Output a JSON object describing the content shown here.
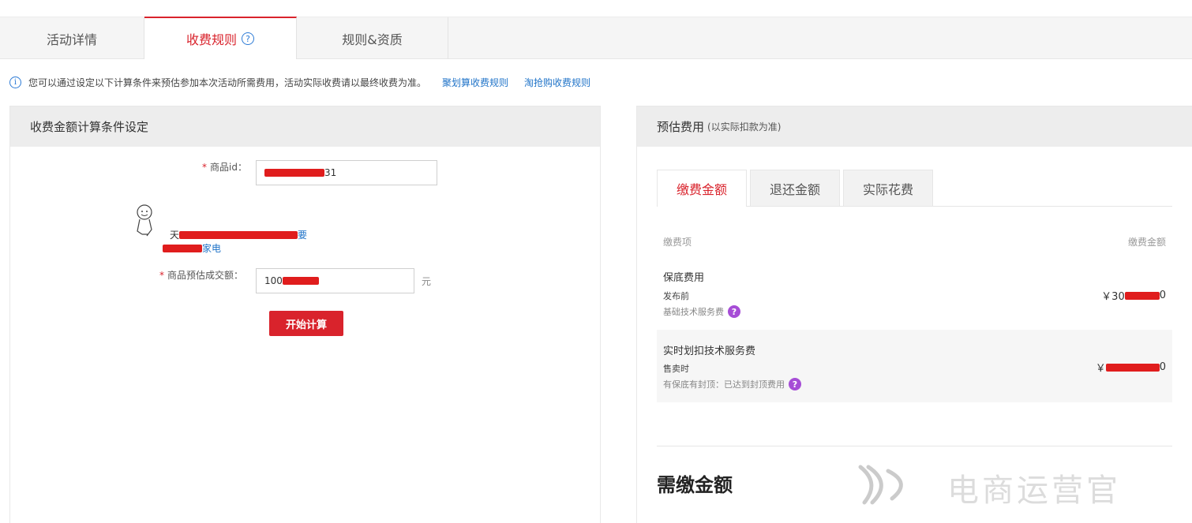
{
  "tabs": [
    {
      "label": "活动详情"
    },
    {
      "label": "收费规则",
      "help": "?"
    },
    {
      "label": "规则&资质"
    }
  ],
  "notice": {
    "text": "您可以通过设定以下计算条件来预估参加本次活动所需费用，活动实际收费请以最终收费为准。",
    "links": [
      "聚划算收费规则",
      "淘抢购收费规则"
    ]
  },
  "left_panel": {
    "title": "收费金额计算条件设定",
    "product_id_label": "商品id：",
    "product_id_value_tail": "31",
    "category_line1_tail": "要",
    "category_line2_tail": "家电",
    "deal_label": "商品预估成交额：",
    "deal_value_head": "100",
    "deal_unit": "元",
    "calc_button": "开始计算"
  },
  "right_panel": {
    "title": "预估费用",
    "title_note": "(以实际扣款为准)",
    "subtabs": [
      "缴费金额",
      "退还金额",
      "实际花费"
    ],
    "col_item": "缴费项",
    "col_amount": "缴费金额",
    "fees": [
      {
        "title": "保底费用",
        "timing": "发布前",
        "note": "基础技术服务费",
        "amount_head": "￥30",
        "amount_tail": "0"
      },
      {
        "title": "实时划扣技术服务费",
        "timing": "售卖时",
        "note": "有保底有封顶：已达到封顶费用",
        "amount_head": "￥",
        "amount_tail": "0"
      }
    ],
    "total_label": "需缴金额"
  },
  "watermark": "电商运营官",
  "colors": {
    "accent": "#d9232c",
    "link": "#1f73c8",
    "help": "#a64dd6"
  }
}
